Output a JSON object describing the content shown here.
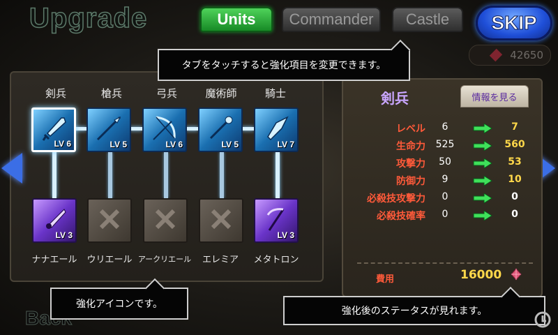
{
  "header": {
    "title": "Upgrade",
    "tabs": [
      {
        "label": "Units",
        "active": true
      },
      {
        "label": "Commander",
        "active": false
      },
      {
        "label": "Castle",
        "active": false
      }
    ],
    "skip_label": "SKIP",
    "currency_value": "42650"
  },
  "callouts": {
    "top": "タブをタッチすると強化項目を変更できます。",
    "bottom_left": "強化アイコンです。",
    "bottom_right": "強化後のステータスが見れます。"
  },
  "units": [
    {
      "name": "剣兵",
      "level": "LV 6",
      "selected": true
    },
    {
      "name": "槍兵",
      "level": "LV 5",
      "selected": false
    },
    {
      "name": "弓兵",
      "level": "LV 6",
      "selected": false
    },
    {
      "name": "魔術師",
      "level": "LV 5",
      "selected": false
    },
    {
      "name": "騎士",
      "level": "LV 7",
      "selected": false
    }
  ],
  "characters": [
    {
      "name": "ナナエール",
      "level": "LV 3",
      "locked": false
    },
    {
      "name": "ウリエール",
      "level": "",
      "locked": true
    },
    {
      "name": "アークリエール",
      "level": "",
      "locked": true
    },
    {
      "name": "エレミア",
      "level": "",
      "locked": true
    },
    {
      "name": "メタトロン",
      "level": "LV 3",
      "locked": false
    }
  ],
  "detail": {
    "unit_title": "剣兵",
    "info_button": "情報を見る",
    "stats": [
      {
        "label": "レベル",
        "current": "6",
        "next": "7",
        "highlight": true
      },
      {
        "label": "生命力",
        "current": "525",
        "next": "560",
        "highlight": true
      },
      {
        "label": "攻撃力",
        "current": "50",
        "next": "53",
        "highlight": true
      },
      {
        "label": "防御力",
        "current": "9",
        "next": "10",
        "highlight": true
      },
      {
        "label": "必殺技攻撃力",
        "current": "0",
        "next": "0",
        "highlight": false
      },
      {
        "label": "必殺技確率",
        "current": "0",
        "next": "0",
        "highlight": false
      }
    ],
    "cost_label": "費用",
    "cost_value": "16000"
  },
  "footer": {
    "back_label": "Back"
  },
  "colors": {
    "stat_label": "#ff5a3a",
    "next_highlight": "#ffd84a",
    "next_plain": "#ffffff",
    "tab_active": "#2fb33e",
    "skip_blue": "#1f4fd8"
  }
}
